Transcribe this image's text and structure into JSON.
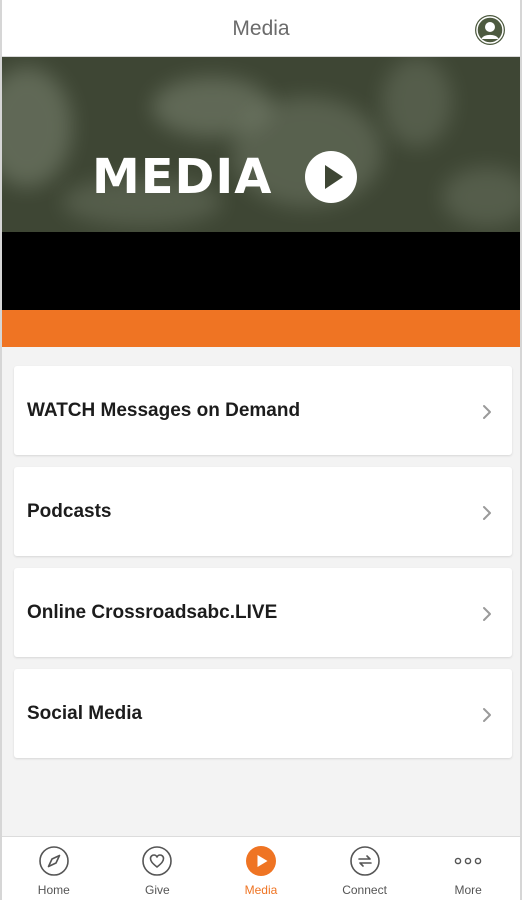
{
  "header": {
    "title": "Media"
  },
  "banner": {
    "word": "MEDIA"
  },
  "menu": {
    "items": [
      {
        "label": "WATCH Messages on Demand"
      },
      {
        "label": "Podcasts"
      },
      {
        "label": "Online Crossroadsabc.LIVE"
      },
      {
        "label": "Social Media"
      }
    ]
  },
  "tabs": [
    {
      "label": "Home",
      "icon": "compass-icon",
      "active": false
    },
    {
      "label": "Give",
      "icon": "heart-icon",
      "active": false
    },
    {
      "label": "Media",
      "icon": "play-icon",
      "active": true
    },
    {
      "label": "Connect",
      "icon": "sync-arrows-icon",
      "active": false
    },
    {
      "label": "More",
      "icon": "more-dots-icon",
      "active": false
    }
  ],
  "colors": {
    "accent": "#ef7423",
    "banner_dark": "#3e4634",
    "profile": "#4d5a3f"
  }
}
